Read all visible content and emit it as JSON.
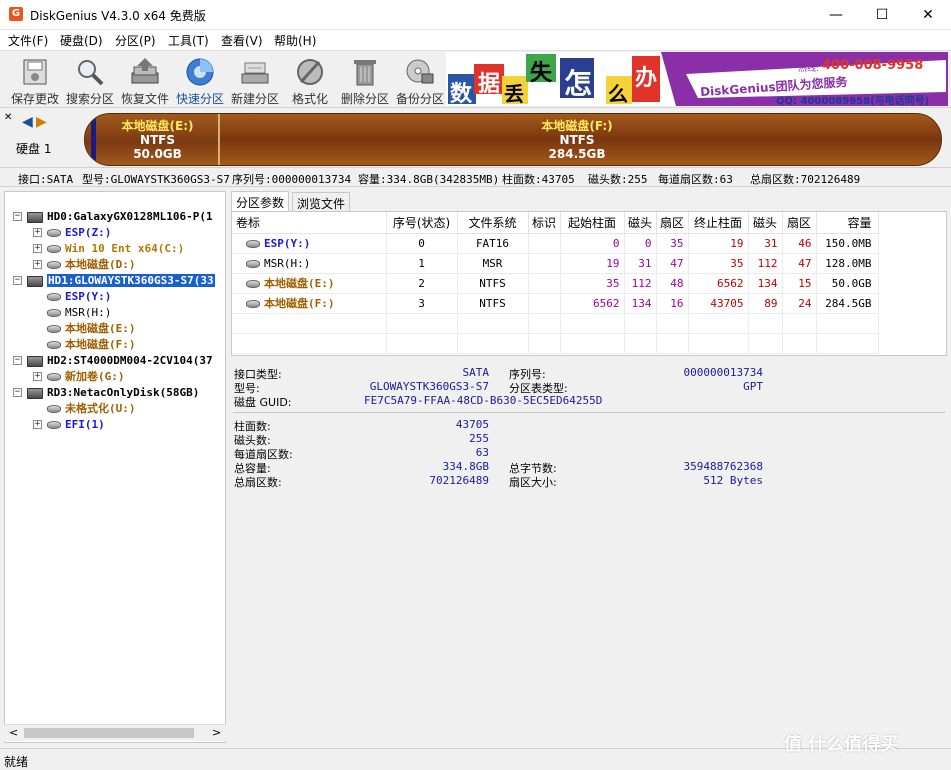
{
  "window": {
    "title": "DiskGenius V4.3.0 x64 免费版",
    "app_icon": "G"
  },
  "menu": [
    "文件(F)",
    "硬盘(D)",
    "分区(P)",
    "工具(T)",
    "查看(V)",
    "帮助(H)"
  ],
  "toolbar": [
    {
      "label": "保存更改",
      "icon": "save-icon"
    },
    {
      "label": "搜索分区",
      "icon": "search-icon"
    },
    {
      "label": "恢复文件",
      "icon": "recover-icon"
    },
    {
      "label": "快速分区",
      "icon": "quick-partition-icon"
    },
    {
      "label": "新建分区",
      "icon": "new-partition-icon"
    },
    {
      "label": "格式化",
      "icon": "format-icon"
    },
    {
      "label": "删除分区",
      "icon": "delete-icon"
    },
    {
      "label": "备份分区",
      "icon": "backup-icon"
    }
  ],
  "banner": {
    "chars": [
      "数",
      "据",
      "丢",
      "失",
      "怎",
      "么",
      "办"
    ],
    "slogan": "DiskGenius团队为您服务",
    "phone": "400-008-9958",
    "phone_label": "热线:",
    "qq": "QQ: 4000089958(与电话同号)"
  },
  "disk_nav": {
    "label": "硬盘 1"
  },
  "disk_map": {
    "left": {
      "name": "本地磁盘(E:)",
      "fs": "NTFS",
      "size": "50.0GB"
    },
    "right": {
      "name": "本地磁盘(F:)",
      "fs": "NTFS",
      "size": "284.5GB"
    }
  },
  "infobar": {
    "interface": "接口:SATA",
    "model": "型号:GLOWAYSTK360GS3-S7",
    "serial": "序列号:000000013734",
    "capacity": "容量:334.8GB(342835MB)",
    "cylinders": "柱面数:43705",
    "heads": "磁头数:255",
    "sectors_per_track": "每道扇区数:63",
    "total_sectors": "总扇区数:702126489"
  },
  "tree": [
    {
      "label": "HD0:GalaxyGX0128ML106-P(1",
      "type": "disk",
      "color": "#000000"
    },
    {
      "label": "ESP(Z:)",
      "type": "vol",
      "color": "#1a1acc"
    },
    {
      "label": "Win 10 Ent x64(C:)",
      "type": "vol",
      "color": "#b07800"
    },
    {
      "label": "本地磁盘(D:)",
      "type": "vol",
      "color": "#a06000"
    },
    {
      "label": "HD1:GLOWAYSTK360GS3-S7(33",
      "type": "disk",
      "color": "#ffffff"
    },
    {
      "label": "ESP(Y:)",
      "type": "vol",
      "color": "#1a1acc"
    },
    {
      "label": "MSR(H:)",
      "type": "vol",
      "color": "#000000"
    },
    {
      "label": "本地磁盘(E:)",
      "type": "vol",
      "color": "#a06000"
    },
    {
      "label": "本地磁盘(F:)",
      "type": "vol",
      "color": "#a06000"
    },
    {
      "label": "HD2:ST4000DM004-2CV104(37",
      "type": "disk",
      "color": "#000000"
    },
    {
      "label": "新加卷(G:)",
      "type": "vol",
      "color": "#a06000"
    },
    {
      "label": "RD3:NetacOnlyDisk(58GB)",
      "type": "disk",
      "color": "#000000"
    },
    {
      "label": "未格式化(U:)",
      "type": "vol",
      "color": "#a06000"
    },
    {
      "label": "EFI(1)",
      "type": "vol",
      "color": "#1a1acc"
    }
  ],
  "tabs": [
    "分区参数",
    "浏览文件"
  ],
  "table": {
    "headers": [
      "卷标",
      "序号(状态)",
      "文件系统",
      "标识",
      "起始柱面",
      "磁头",
      "扇区",
      "终止柱面",
      "磁头",
      "扇区",
      "容量"
    ],
    "rows": [
      {
        "label": "ESP(Y:)",
        "color": "#1a1acc",
        "index": "0",
        "fs": "FAT16",
        "id": "",
        "start_cyl": "0",
        "start_head": "0",
        "start_sec": "35",
        "end_cyl": "19",
        "end_head": "31",
        "end_sec": "46",
        "size": "150.0MB"
      },
      {
        "label": "MSR(H:)",
        "color": "#000000",
        "index": "1",
        "fs": "MSR",
        "id": "",
        "start_cyl": "19",
        "start_head": "31",
        "start_sec": "47",
        "end_cyl": "35",
        "end_head": "112",
        "end_sec": "47",
        "size": "128.0MB"
      },
      {
        "label": "本地磁盘(E:)",
        "color": "#a06000",
        "index": "2",
        "fs": "NTFS",
        "id": "",
        "start_cyl": "35",
        "start_head": "112",
        "start_sec": "48",
        "end_cyl": "6562",
        "end_head": "134",
        "end_sec": "15",
        "size": "50.0GB"
      },
      {
        "label": "本地磁盘(F:)",
        "color": "#a06000",
        "index": "3",
        "fs": "NTFS",
        "id": "",
        "start_cyl": "6562",
        "start_head": "134",
        "start_sec": "16",
        "end_cyl": "43705",
        "end_head": "89",
        "end_sec": "24",
        "size": "284.5GB"
      }
    ]
  },
  "details": {
    "interface_type_label": "接口类型:",
    "interface_type": "SATA",
    "serial_label": "序列号:",
    "serial": "000000013734",
    "model_label": "型号:",
    "model": "GLOWAYSTK360GS3-S7",
    "pt_type_label": "分区表类型:",
    "pt_type": "GPT",
    "guid_label": "磁盘 GUID:",
    "guid": "FE7C5A79-FFAA-48CD-B630-5EC5ED64255D",
    "cyl_label": "柱面数:",
    "cyl": "43705",
    "heads_label": "磁头数:",
    "heads": "255",
    "spt_label": "每道扇区数:",
    "spt": "63",
    "capacity_label": "总容量:",
    "capacity": "334.8GB",
    "total_bytes_label": "总字节数:",
    "total_bytes": "359488762368",
    "total_sectors_label": "总扇区数:",
    "total_sectors": "702126489",
    "sector_size_label": "扇区大小:",
    "sector_size": "512 Bytes"
  },
  "status": "就绪",
  "watermark": "值 什么值得买"
}
